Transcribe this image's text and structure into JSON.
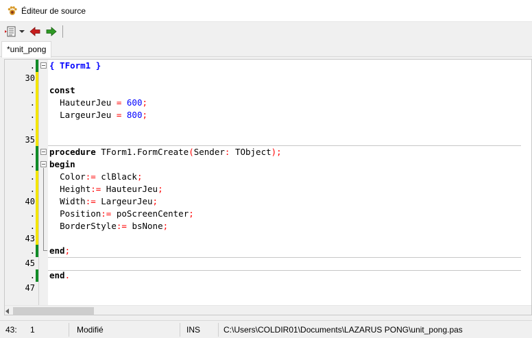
{
  "window": {
    "title": "Éditeur de source",
    "icon": "lazarus-paw-icon"
  },
  "toolbar": {
    "buttons": [
      {
        "icon": "source-jump-menu-icon"
      },
      {
        "icon": "dropdown-arrow-icon"
      },
      {
        "icon": "back-arrow-icon"
      },
      {
        "icon": "forward-arrow-icon"
      }
    ]
  },
  "tabs": [
    {
      "label": "*unit_pong",
      "active": true
    }
  ],
  "gutter": {
    "numbers": [
      ".",
      "30",
      ".",
      ".",
      ".",
      ".",
      "35",
      ".",
      ".",
      ".",
      ".",
      "40",
      ".",
      ".",
      "43",
      ".",
      "45",
      ".",
      "47"
    ]
  },
  "code": {
    "line1_comment": "{ TForm1 }",
    "line3_kw": "const",
    "line4_name": "HauteurJeu",
    "line4_eq": " = ",
    "line4_num": "600",
    "line4_semi": ";",
    "line5_name": "LargeurJeu",
    "line5_eq": " = ",
    "line5_num": "800",
    "line5_semi": ";",
    "line8_kw": "procedure",
    "line8_name": " TForm1.FormCreate",
    "line8_lp": "(",
    "line8_arg": "Sender",
    "line8_colon": ": ",
    "line8_type": "TObject",
    "line8_rp": ");",
    "line9_kw": "begin",
    "line10_name": "Color",
    "line10_op": ":= ",
    "line10_val": "clBlack",
    "line10_semi": ";",
    "line11_name": "Height",
    "line11_op": ":= ",
    "line11_val": "HauteurJeu",
    "line11_semi": ";",
    "line12_name": "Width",
    "line12_op": ":= ",
    "line12_val": "LargeurJeu",
    "line12_semi": ";",
    "line13_name": "Position",
    "line13_op": ":= ",
    "line13_val": "poScreenCenter",
    "line13_semi": ";",
    "line14_name": "BorderStyle",
    "line14_op": ":= ",
    "line14_val": "bsNone",
    "line14_semi": ";",
    "line16_kw": "end",
    "line16_semi": ";",
    "line18_kw": "end",
    "line18_dot": "."
  },
  "status": {
    "cursor_line": "43:",
    "cursor_col": "1",
    "modified": "Modifié",
    "insert_mode": "INS",
    "file_path": "C:\\Users\\COLDIR01\\Documents\\LAZARUS PONG\\unit_pong.pas"
  },
  "colors": {
    "keyword": "#000000",
    "comment": "#0000ff",
    "number": "#0000ff",
    "symbol": "#ff0000",
    "change_saved": "#108a26",
    "change_unsaved": "#f3e500"
  }
}
